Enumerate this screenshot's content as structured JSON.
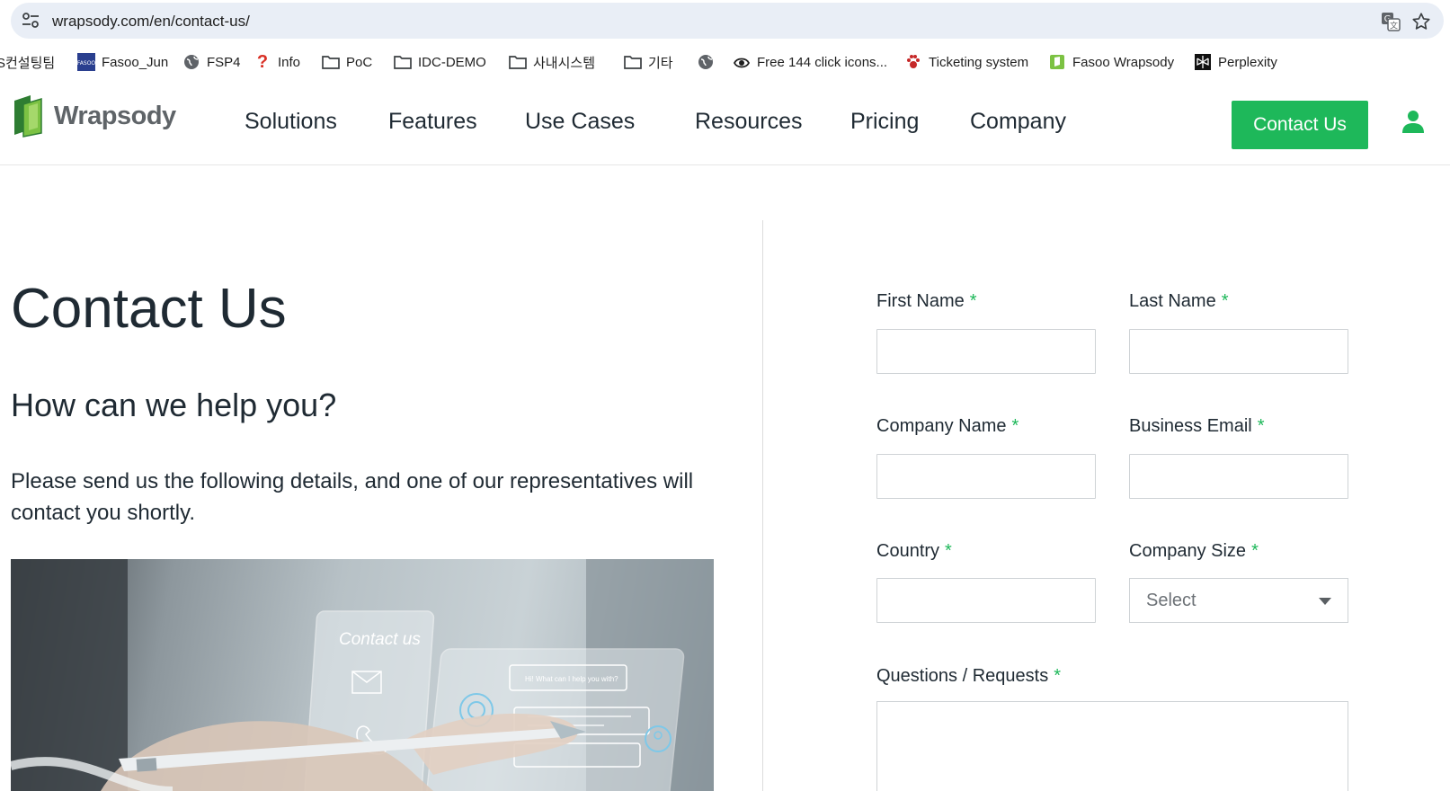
{
  "browser": {
    "url": "wrapsody.com/en/contact-us/",
    "icons": {
      "site_settings": "tune-icon",
      "translate": "translate-icon",
      "bookmark": "star-icon"
    },
    "bookmarks": [
      {
        "label": "S컨설팅팀",
        "icon": ""
      },
      {
        "label": "Fasoo_Jun",
        "icon": "fasoo-icon"
      },
      {
        "label": "FSP4",
        "icon": "globe-icon"
      },
      {
        "label": "Info",
        "icon": "question-icon"
      },
      {
        "label": "PoC",
        "icon": "folder-icon"
      },
      {
        "label": "IDC-DEMO",
        "icon": "folder-icon"
      },
      {
        "label": "사내시스템",
        "icon": "folder-icon"
      },
      {
        "label": "기타",
        "icon": "folder-icon"
      },
      {
        "label": "",
        "icon": "globe-icon"
      },
      {
        "label": "Free 144 click icons...",
        "icon": "eye-icon"
      },
      {
        "label": "Ticketing system",
        "icon": "paw-icon"
      },
      {
        "label": "Fasoo Wrapsody",
        "icon": "wrapsody-icon"
      },
      {
        "label": "Perplexity",
        "icon": "perplexity-icon"
      }
    ]
  },
  "header": {
    "logo_text": "Wrapsody",
    "nav": [
      "Solutions",
      "Features",
      "Use Cases",
      "Resources",
      "Pricing",
      "Company"
    ],
    "cta_label": "Contact Us",
    "brand_color": "#1eb85a"
  },
  "main": {
    "title": "Contact Us",
    "subtitle": "How can we help you?",
    "intro": "Please send us the following details, and one of our representatives will contact you shortly.",
    "hero_texts": {
      "card1": "Contact us",
      "card2": "Hi! What can I help you with?"
    }
  },
  "form": {
    "required_mark": "*",
    "first_name": {
      "label": "First Name",
      "value": ""
    },
    "last_name": {
      "label": "Last Name",
      "value": ""
    },
    "company_name": {
      "label": "Company Name",
      "value": ""
    },
    "business_email": {
      "label": "Business Email",
      "value": ""
    },
    "country": {
      "label": "Country",
      "value": ""
    },
    "company_size": {
      "label": "Company Size",
      "selected": "Select"
    },
    "questions": {
      "label": "Questions / Requests",
      "value": ""
    }
  }
}
